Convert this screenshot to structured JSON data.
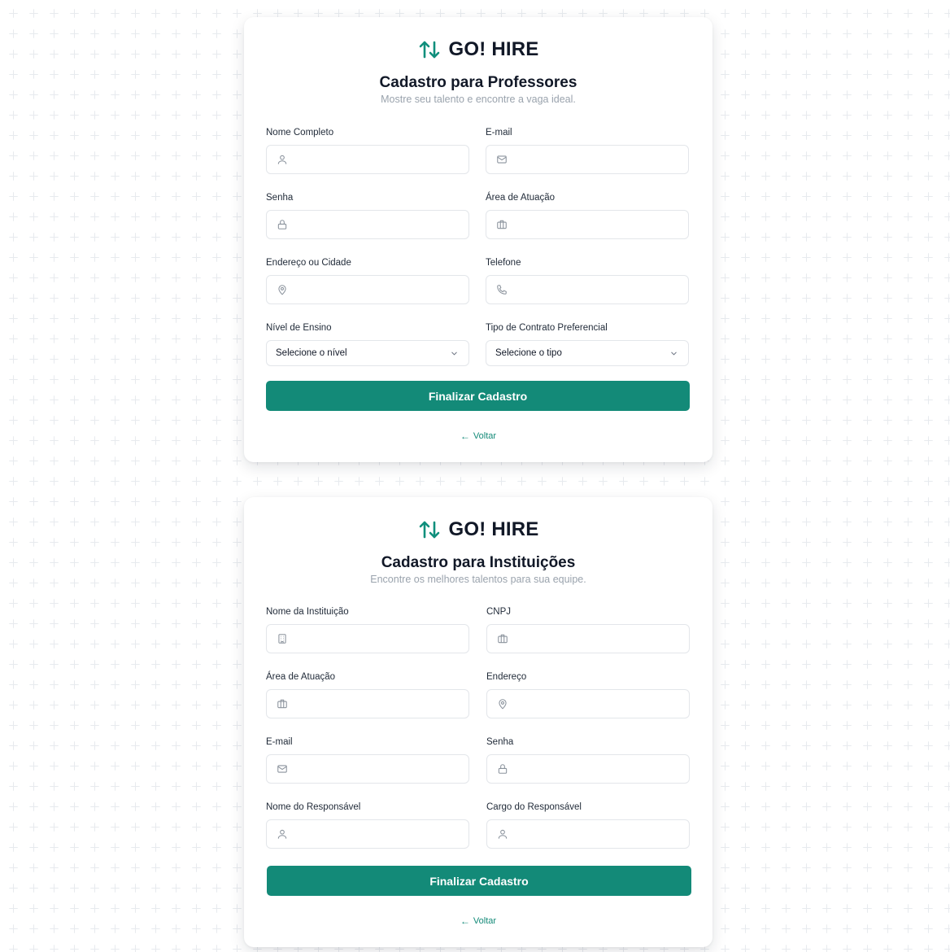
{
  "brand": {
    "name": "GO! HIRE",
    "icon": "arrows-up-down-icon"
  },
  "colors": {
    "accent": "#138a78",
    "brand_icon": "#0f8f7c",
    "subtitle": "#9aa3ad",
    "background": "#ffffff"
  },
  "teacher_form": {
    "title": "Cadastro para Professores",
    "subtitle": "Mostre seu talento e encontre a vaga ideal.",
    "fields": {
      "full_name": {
        "label": "Nome Completo",
        "icon": "user-icon",
        "value": ""
      },
      "email": {
        "label": "E-mail",
        "icon": "mail-icon",
        "value": ""
      },
      "password": {
        "label": "Senha",
        "icon": "lock-icon",
        "value": ""
      },
      "area": {
        "label": "Área de Atuação",
        "icon": "briefcase-icon",
        "value": ""
      },
      "address": {
        "label": "Endereço ou Cidade",
        "icon": "map-pin-icon",
        "value": ""
      },
      "phone": {
        "label": "Telefone",
        "icon": "phone-icon",
        "value": ""
      }
    },
    "selects": {
      "level": {
        "label": "Nível de Ensino",
        "selected": "Selecione o nível"
      },
      "contract": {
        "label": "Tipo de Contrato Preferencial",
        "selected": "Selecione o tipo"
      }
    },
    "submit_label": "Finalizar Cadastro",
    "back_label": "Voltar"
  },
  "institution_form": {
    "title": "Cadastro para Instituições",
    "subtitle": "Encontre os melhores talentos para sua equipe.",
    "fields": {
      "institution_name": {
        "label": "Nome da Instituição",
        "icon": "building-icon",
        "value": ""
      },
      "cnpj": {
        "label": "CNPJ",
        "icon": "briefcase-icon",
        "value": ""
      },
      "area": {
        "label": "Área de Atuação",
        "icon": "briefcase-icon",
        "value": ""
      },
      "address": {
        "label": "Endereço",
        "icon": "map-pin-icon",
        "value": ""
      },
      "email": {
        "label": "E-mail",
        "icon": "mail-icon",
        "value": ""
      },
      "password": {
        "label": "Senha",
        "icon": "lock-icon",
        "value": ""
      },
      "responsible_name": {
        "label": "Nome do Responsável",
        "icon": "user-icon",
        "value": ""
      },
      "responsible_role": {
        "label": "Cargo do Responsável",
        "icon": "user-icon",
        "value": ""
      }
    },
    "submit_label": "Finalizar Cadastro",
    "back_label": "Voltar"
  }
}
